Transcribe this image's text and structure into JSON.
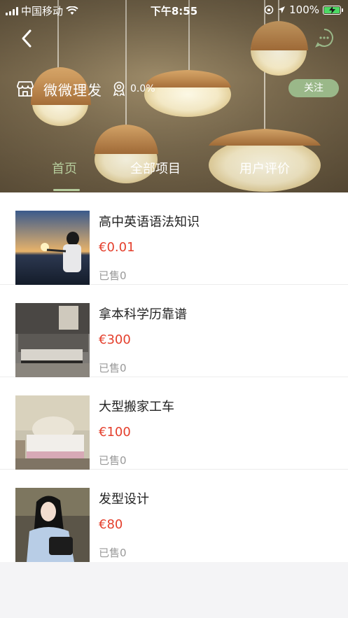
{
  "status_bar": {
    "carrier": "中国移动",
    "time": "下午8:55",
    "battery": "100%"
  },
  "shop": {
    "name": "微微理发",
    "rating": "0.0%",
    "follow_label": "关注"
  },
  "tabs": [
    {
      "label": "首页",
      "active": true
    },
    {
      "label": "全部项目",
      "active": false
    },
    {
      "label": "用户评价",
      "active": false
    }
  ],
  "items": [
    {
      "title": "高中英语语法知识",
      "price": "€0.01",
      "sold": "已售0"
    },
    {
      "title": "拿本科学历靠谱",
      "price": "€300",
      "sold": "已售0"
    },
    {
      "title": "大型搬家工车",
      "price": "€100",
      "sold": "已售0"
    },
    {
      "title": "发型设计",
      "price": "€80",
      "sold": "已售0"
    }
  ],
  "colors": {
    "accent_green": "#b6cc9c",
    "follow_bg": "#9ab889",
    "price_red": "#e43f2c"
  },
  "icons": [
    "back-chevron",
    "message-bubble",
    "shop",
    "award-badge",
    "wifi",
    "location-arrow",
    "lock-rotation",
    "battery"
  ]
}
